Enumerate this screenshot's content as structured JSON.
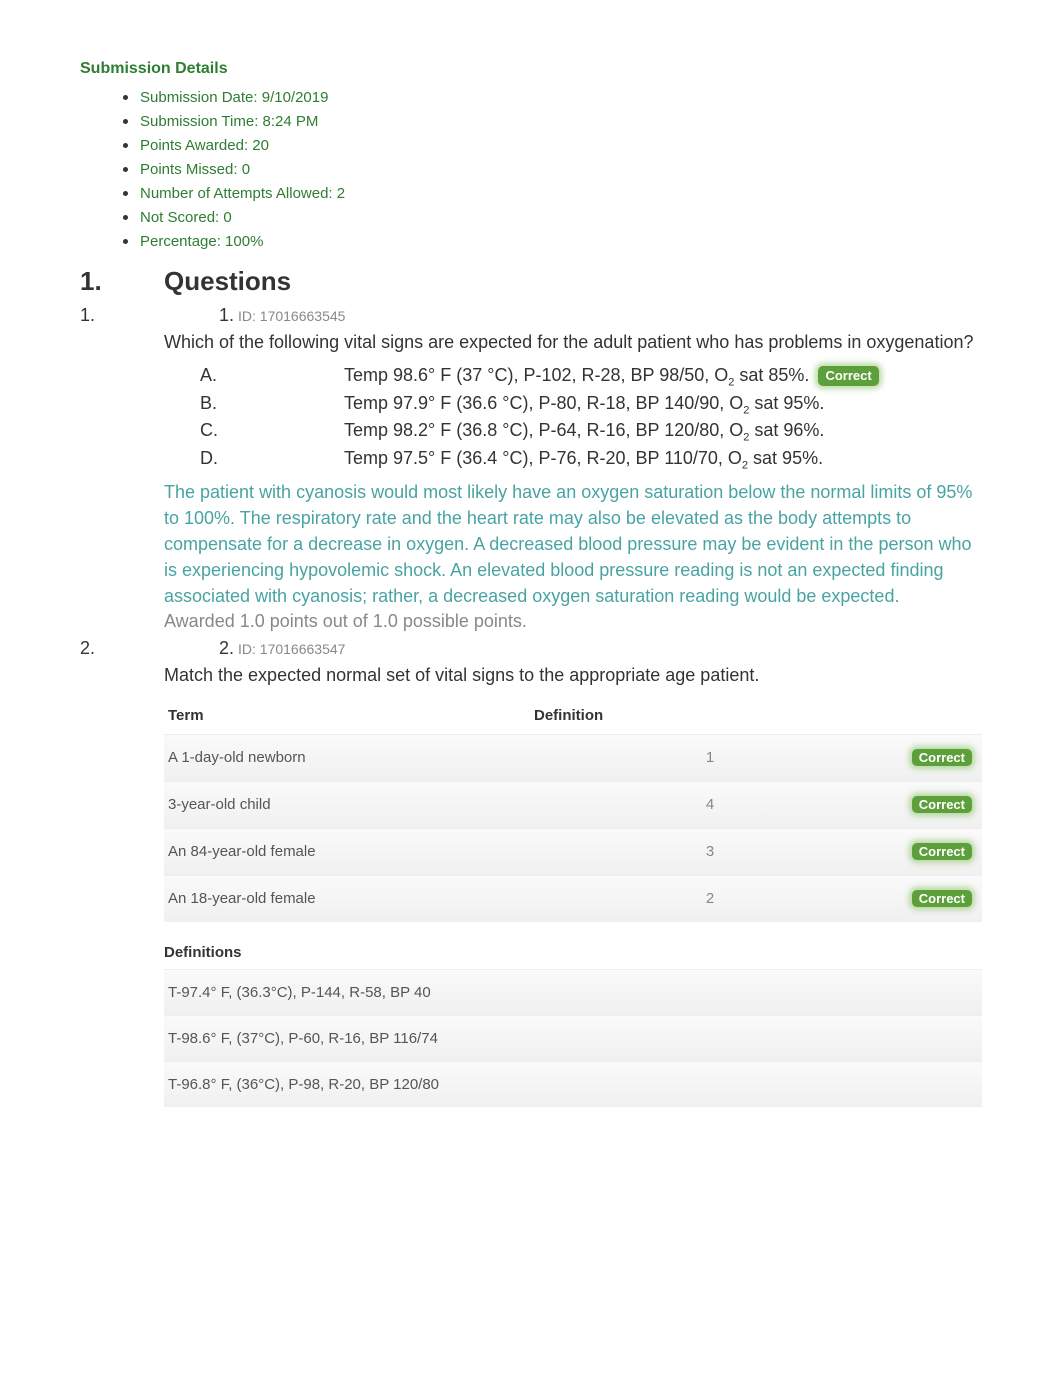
{
  "submission": {
    "title": "Submission Details",
    "items": [
      "Submission Date: 9/10/2019",
      "Submission Time: 8:24 PM",
      "Points Awarded: 20",
      "Points Missed: 0",
      "Number of Attempts Allowed: 2",
      "Not Scored: 0",
      "Percentage: 100%"
    ]
  },
  "section": {
    "number": "1.",
    "title": "Questions"
  },
  "correct_label": "Correct",
  "q1": {
    "outer": "1.",
    "inner": "1.",
    "id_label": "ID: 17016663545",
    "text": "Which of the following vital signs are expected for the adult patient who has problems in oxygenation?",
    "options": [
      {
        "letter": "A.",
        "text_pre": "Temp 98.6° F (37 °C), P-102, R-28, BP 98/50, O",
        "text_post": " sat 85%.",
        "correct": true
      },
      {
        "letter": "B.",
        "text_pre": "Temp 97.9° F (36.6 °C), P-80, R-18, BP 140/90, O",
        "text_post": " sat 95%.",
        "correct": false
      },
      {
        "letter": "C.",
        "text_pre": "Temp 98.2° F (36.8 °C), P-64, R-16, BP 120/80, O",
        "text_post": " sat 96%.",
        "correct": false
      },
      {
        "letter": "D.",
        "text_pre": "Temp 97.5° F (36.4 °C), P-76, R-20, BP 110/70, O",
        "text_post": " sat 95%.",
        "correct": false
      }
    ],
    "rationale": "The patient with cyanosis would most likely have an oxygen saturation below the normal limits of 95% to 100%. The respiratory rate and the heart rate may also be elevated as the body attempts to compensate for a decrease in oxygen. A decreased blood pressure may be evident in the person who is experiencing hypovolemic shock. An elevated blood pressure reading is not an expected finding associated with cyanosis; rather, a decreased oxygen saturation reading would be expected.",
    "awarded": "Awarded 1.0 points out of 1.0 possible points."
  },
  "q2": {
    "outer": "2.",
    "inner": "2.",
    "id_label": "ID: 17016663547",
    "text": "Match the expected normal set of vital signs to the appropriate age patient.",
    "headers": {
      "term": "Term",
      "definition": "Definition"
    },
    "rows": [
      {
        "term": "A 1-day-old newborn",
        "answer": "1"
      },
      {
        "term": "3-year-old child",
        "answer": "4"
      },
      {
        "term": "An 84-year-old female",
        "answer": "3"
      },
      {
        "term": "An 18-year-old female",
        "answer": "2"
      }
    ],
    "defs_title": "Definitions",
    "definitions": [
      "T-97.4° F, (36.3°C), P-144, R-58, BP 40",
      "T-98.6° F, (37°C), P-60, R-16, BP 116/74",
      "T-96.8° F, (36°C), P-98, R-20, BP 120/80"
    ]
  }
}
